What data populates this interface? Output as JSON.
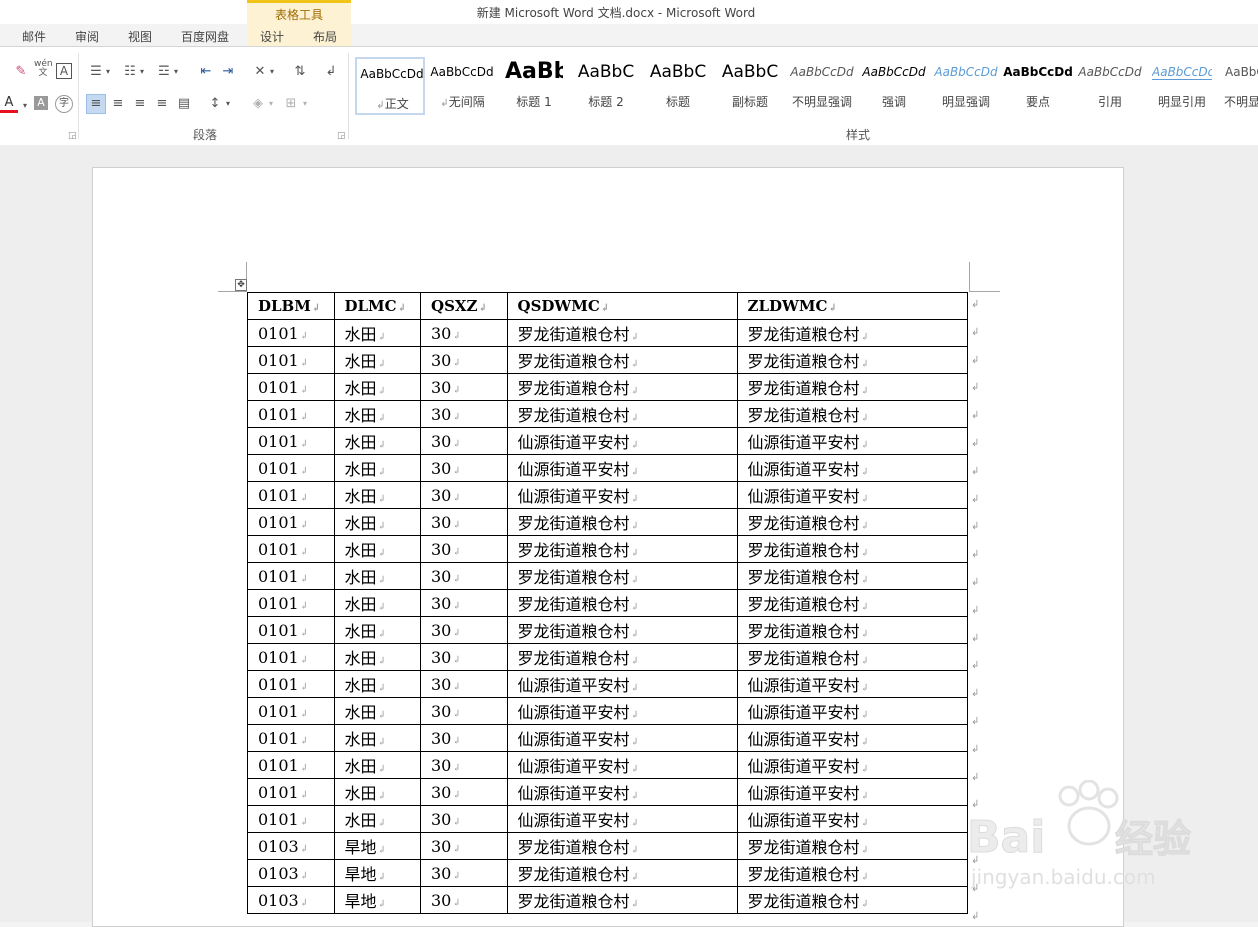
{
  "window": {
    "title": "新建 Microsoft Word 文档.docx - Microsoft Word",
    "context_tools_label": "表格工具"
  },
  "tabs": [
    "邮件",
    "审阅",
    "视图",
    "百度网盘",
    "设计",
    "布局"
  ],
  "ribbon": {
    "paragraph_group_label": "段落",
    "styles_group_label": "样式",
    "styles": [
      {
        "preview": "AaBbCcDd",
        "name": "正文"
      },
      {
        "preview": "AaBbCcDd",
        "name": "无间隔"
      },
      {
        "preview": "AaBb",
        "name": "标题 1"
      },
      {
        "preview": "AaBbC",
        "name": "标题 2"
      },
      {
        "preview": "AaBbC",
        "name": "标题"
      },
      {
        "preview": "AaBbC",
        "name": "副标题"
      },
      {
        "preview": "AaBbCcDd",
        "name": "不明显强调"
      },
      {
        "preview": "AaBbCcDd",
        "name": "强调"
      },
      {
        "preview": "AaBbCcDd",
        "name": "明显强调"
      },
      {
        "preview": "AaBbCcDd",
        "name": "要点"
      },
      {
        "preview": "AaBbCcDd",
        "name": "引用"
      },
      {
        "preview": "AaBbCcDd",
        "name": "明显引用"
      },
      {
        "preview": "AaBbCcDd",
        "name": "不明显"
      }
    ],
    "icons": {
      "pinyin_top": "wén",
      "pinyin_bottom": "文",
      "char_border": "A",
      "font_color": "A",
      "char_shading": "A",
      "enclose_char": "字"
    }
  },
  "table": {
    "headers": [
      "DLBM",
      "DLMC",
      "QSXZ",
      "QSDWMC",
      "ZLDWMC"
    ],
    "rows": [
      [
        "0101",
        "水田",
        "30",
        "罗龙街道粮仓村",
        "罗龙街道粮仓村"
      ],
      [
        "0101",
        "水田",
        "30",
        "罗龙街道粮仓村",
        "罗龙街道粮仓村"
      ],
      [
        "0101",
        "水田",
        "30",
        "罗龙街道粮仓村",
        "罗龙街道粮仓村"
      ],
      [
        "0101",
        "水田",
        "30",
        "罗龙街道粮仓村",
        "罗龙街道粮仓村"
      ],
      [
        "0101",
        "水田",
        "30",
        "仙源街道平安村",
        "仙源街道平安村"
      ],
      [
        "0101",
        "水田",
        "30",
        "仙源街道平安村",
        "仙源街道平安村"
      ],
      [
        "0101",
        "水田",
        "30",
        "仙源街道平安村",
        "仙源街道平安村"
      ],
      [
        "0101",
        "水田",
        "30",
        "罗龙街道粮仓村",
        "罗龙街道粮仓村"
      ],
      [
        "0101",
        "水田",
        "30",
        "罗龙街道粮仓村",
        "罗龙街道粮仓村"
      ],
      [
        "0101",
        "水田",
        "30",
        "罗龙街道粮仓村",
        "罗龙街道粮仓村"
      ],
      [
        "0101",
        "水田",
        "30",
        "罗龙街道粮仓村",
        "罗龙街道粮仓村"
      ],
      [
        "0101",
        "水田",
        "30",
        "罗龙街道粮仓村",
        "罗龙街道粮仓村"
      ],
      [
        "0101",
        "水田",
        "30",
        "罗龙街道粮仓村",
        "罗龙街道粮仓村"
      ],
      [
        "0101",
        "水田",
        "30",
        "仙源街道平安村",
        "仙源街道平安村"
      ],
      [
        "0101",
        "水田",
        "30",
        "仙源街道平安村",
        "仙源街道平安村"
      ],
      [
        "0101",
        "水田",
        "30",
        "仙源街道平安村",
        "仙源街道平安村"
      ],
      [
        "0101",
        "水田",
        "30",
        "仙源街道平安村",
        "仙源街道平安村"
      ],
      [
        "0101",
        "水田",
        "30",
        "仙源街道平安村",
        "仙源街道平安村"
      ],
      [
        "0101",
        "水田",
        "30",
        "仙源街道平安村",
        "仙源街道平安村"
      ],
      [
        "0103",
        "旱地",
        "30",
        "罗龙街道粮仓村",
        "罗龙街道粮仓村"
      ],
      [
        "0103",
        "旱地",
        "30",
        "罗龙街道粮仓村",
        "罗龙街道粮仓村"
      ],
      [
        "0103",
        "旱地",
        "30",
        "罗龙街道粮仓村",
        "罗龙街道粮仓村"
      ]
    ]
  },
  "watermark": {
    "brand_left": "Bai",
    "brand_right": "经验",
    "url": "jingyan.baidu.com"
  },
  "colors": {
    "accent": "#2b579a",
    "context_tab": "#f0c419",
    "font_color_bar": "#e81123"
  }
}
